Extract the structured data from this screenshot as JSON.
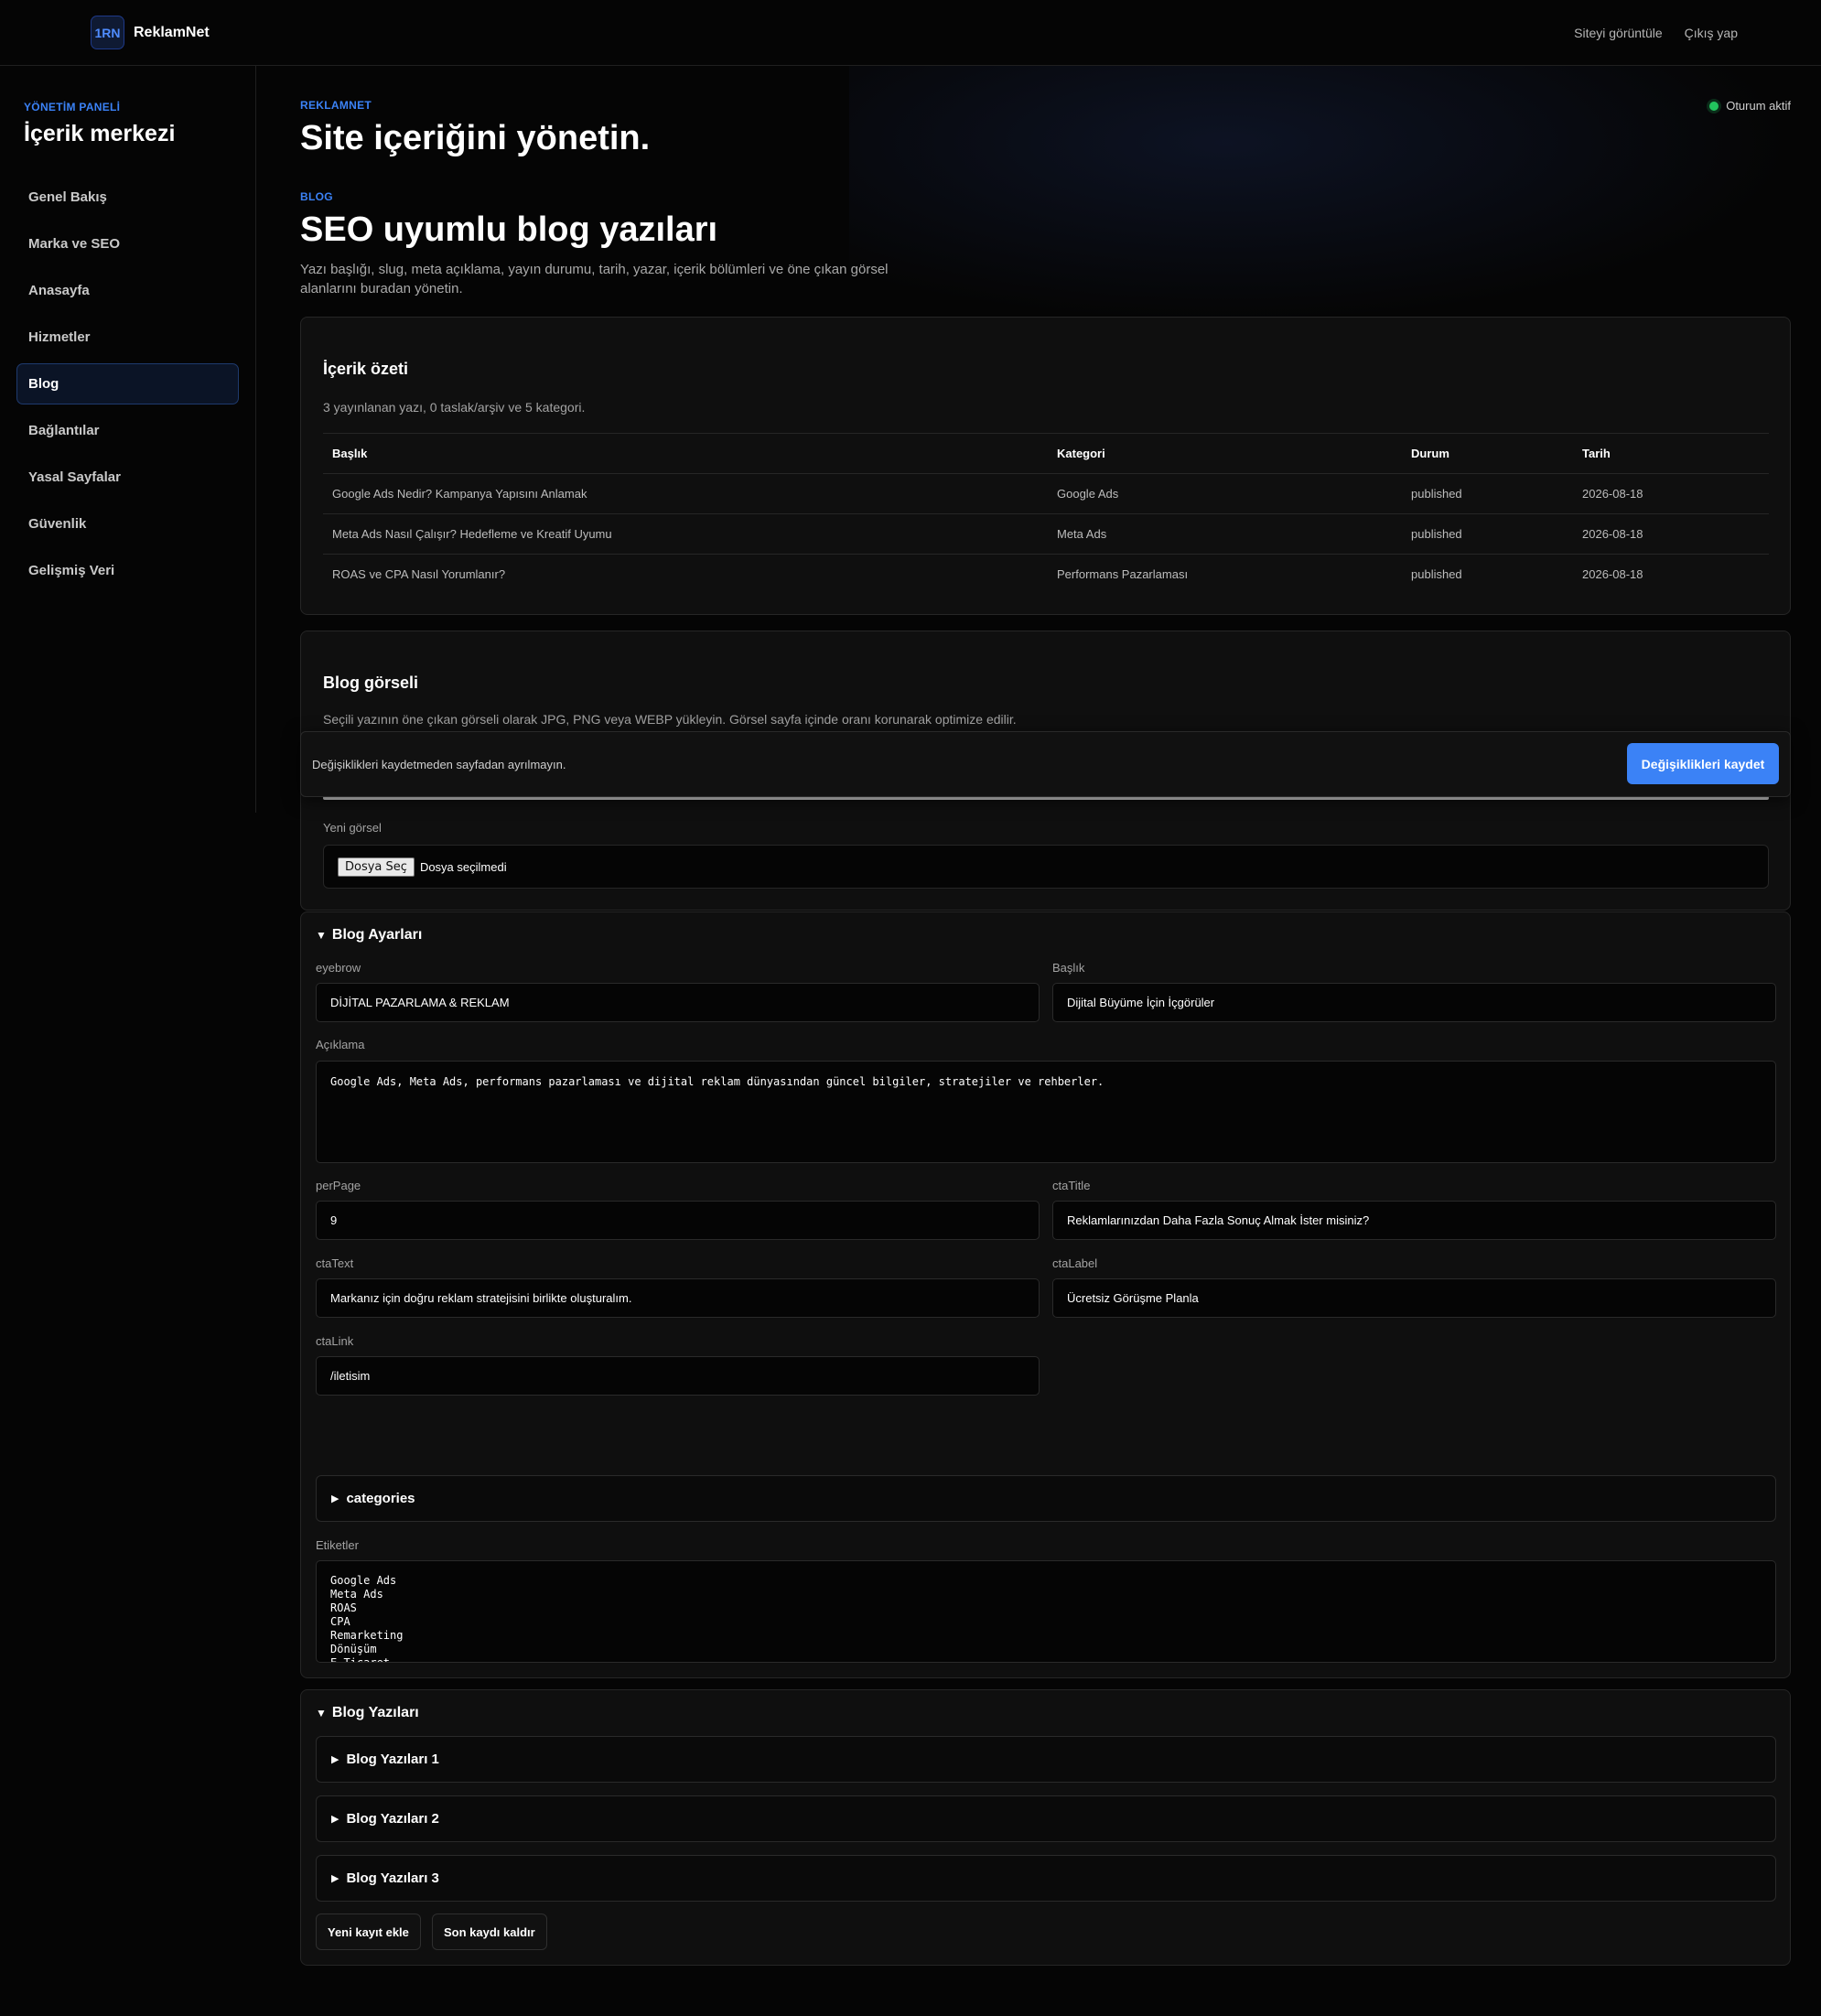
{
  "brand": {
    "logo_text": "1RN",
    "name": "ReklamNet"
  },
  "top_links": {
    "view_site": "Siteyi görüntüle",
    "logout": "Çıkış yap"
  },
  "sidebar": {
    "kicker": "YÖNETİM PANELİ",
    "title": "İçerik merkezi",
    "items": [
      {
        "label": "Genel Bakış"
      },
      {
        "label": "Marka ve SEO"
      },
      {
        "label": "Anasayfa"
      },
      {
        "label": "Hizmetler"
      },
      {
        "label": "Blog",
        "active": true
      },
      {
        "label": "Bağlantılar"
      },
      {
        "label": "Yasal Sayfalar"
      },
      {
        "label": "Güvenlik"
      },
      {
        "label": "Gelişmiş Veri"
      }
    ]
  },
  "header": {
    "kicker": "REKLAMNET",
    "title": "Site içeriğini yönetin.",
    "status": "Oturum aktif",
    "section_kicker": "BLOG",
    "section_title": "SEO uyumlu blog yazıları",
    "lead": "Yazı başlığı, slug, meta açıklama, yayın durumu, tarih, yazar, içerik bölümleri ve öne çıkan görsel alanlarını buradan yönetin."
  },
  "summary": {
    "title": "İçerik özeti",
    "text": "3 yayınlanan yazı, 0 taslak/arşiv ve 5 kategori.",
    "columns": [
      "Başlık",
      "Kategori",
      "Durum",
      "Tarih"
    ],
    "rows": [
      [
        "Google Ads Nedir? Kampanya Yapısını Anlamak",
        "Google Ads",
        "published",
        "2026-08-18"
      ],
      [
        "Meta Ads Nasıl Çalışır? Hedefleme ve Kreatif Uyumu",
        "Meta Ads",
        "published",
        "2026-08-18"
      ],
      [
        "ROAS ve CPA Nasıl Yorumlanır?",
        "Performans Pazarlaması",
        "published",
        "2026-08-18"
      ]
    ]
  },
  "image_card": {
    "title": "Blog görseli",
    "text": "Seçili yazının öne çıkan görseli olarak JPG, PNG veya WEBP yükleyin. Görsel sayfa içinde oranı korunarak optimize edilir.",
    "new_image_label": "Yeni görsel",
    "file_button": "Dosya Seç",
    "file_status": "Dosya seçilmedi"
  },
  "savebar": {
    "text": "Değişiklikleri kaydetmeden sayfadan ayrılmayın.",
    "button": "Değişiklikleri kaydet"
  },
  "settings": {
    "title": "Blog Ayarları",
    "eyebrow_label": "eyebrow",
    "eyebrow_value": "DİJİTAL PAZARLAMA & REKLAM",
    "baslik_label": "Başlık",
    "baslik_value": "Dijital Büyüme İçin İçgörüler",
    "aciklama_label": "Açıklama",
    "aciklama_value": "Google Ads, Meta Ads, performans pazarlaması ve dijital reklam dünyasından güncel bilgiler, stratejiler ve rehberler.",
    "perpage_label": "perPage",
    "perpage_value": "9",
    "ctatitle_label": "ctaTitle",
    "ctatitle_value": "Reklamlarınızdan Daha Fazla Sonuç Almak İster misiniz?",
    "ctatext_label": "ctaText",
    "ctatext_value": "Markanız için doğru reklam stratejisini birlikte oluşturalım.",
    "ctalabel_label": "ctaLabel",
    "ctalabel_value": "Ücretsiz Görüşme Planla",
    "ctalink_label": "ctaLink",
    "ctalink_value": "/iletisim",
    "categories_label": "categories",
    "etiketler_label": "Etiketler",
    "etiketler_value": "Google Ads\nMeta Ads\nROAS\nCPA\nRemarketing\nDönüşüm\nE-Ticaret"
  },
  "posts": {
    "title": "Blog Yazıları",
    "items": [
      "Blog Yazıları 1",
      "Blog Yazıları 2",
      "Blog Yazıları 3"
    ],
    "add_button": "Yeni kayıt ekle",
    "remove_button": "Son kaydı kaldır"
  }
}
